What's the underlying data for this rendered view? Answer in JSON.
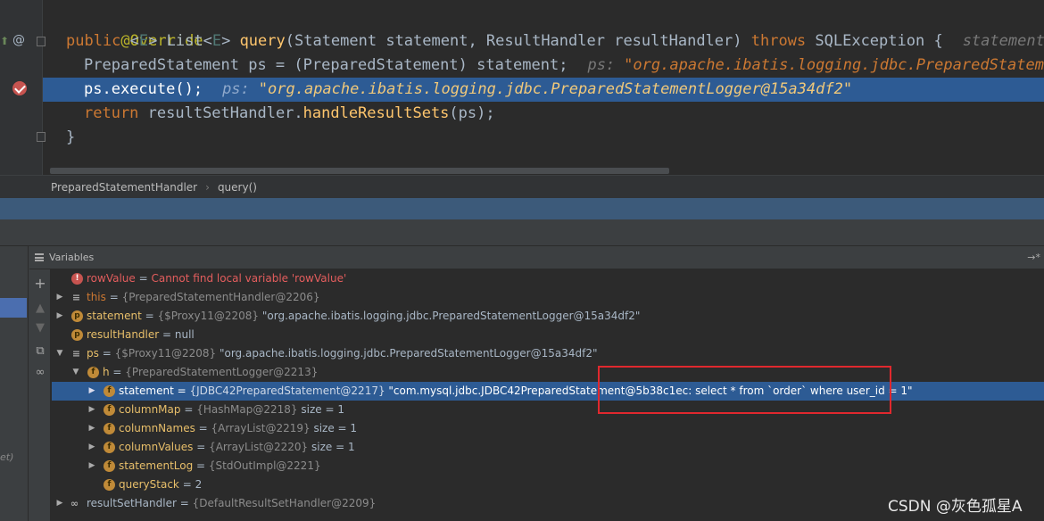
{
  "editor": {
    "lines": {
      "l1": "@Override",
      "l2_public": "public",
      "l2_lt": " <",
      "l2_E": "E",
      "l2_gt": "> ",
      "l2_list": "List<",
      "l2_E2": "E",
      "l2_gt2": "> ",
      "l2_query": "query",
      "l2_params": "(Statement statement, ResultHandler resultHandler) ",
      "l2_throws": "throws",
      "l2_exc": " SQLException {",
      "l2_hint": "statement: \"",
      "l3_code": "PreparedStatement ps = (PreparedStatement) statement;",
      "l3_hint_name": "ps:",
      "l3_hint_val": "\"org.apache.ibatis.logging.jdbc.PreparedStatement",
      "l4_code": "ps.execute();",
      "l4_hint_name": "ps:",
      "l4_hint_val": "\"org.apache.ibatis.logging.jdbc.PreparedStatementLogger@15a34df2\"",
      "l5_return": "return",
      "l5_code": " resultSetHandler.",
      "l5_fn": "handleResultSets",
      "l5_end": "(ps);",
      "l6": "}"
    },
    "gutter_at": "@"
  },
  "breadcrumb": {
    "class": "PreparedStatementHandler",
    "method": "query()"
  },
  "variables": {
    "title": "Variables",
    "pin": "→*",
    "frame_partial": "et)",
    "rows": [
      {
        "name": "rowValue",
        "eq": " = ",
        "value": "Cannot find local variable 'rowValue'"
      },
      {
        "name": "this",
        "eq": " = ",
        "ref": "{PreparedStatementHandler@2206}"
      },
      {
        "name": "statement",
        "eq": " = ",
        "ref": "{$Proxy11@2208}",
        "value": " \"org.apache.ibatis.logging.jdbc.PreparedStatementLogger@15a34df2\""
      },
      {
        "name": "resultHandler",
        "eq": " = ",
        "value": "null"
      },
      {
        "name": "ps",
        "eq": " = ",
        "ref": "{$Proxy11@2208}",
        "value": " \"org.apache.ibatis.logging.jdbc.PreparedStatementLogger@15a34df2\""
      },
      {
        "name": "h",
        "eq": " = ",
        "ref": "{PreparedStatementLogger@2213}"
      },
      {
        "name": "statement",
        "eq": " = ",
        "ref": "{JDBC42PreparedStatement@2217}",
        "value": " \"com.mysql.jdbc.JDBC42PreparedStatement@5b38c1ec: select * from `order` where user_id = 1\""
      },
      {
        "name": "columnMap",
        "eq": " = ",
        "ref": "{HashMap@2218}",
        "value": "  size = 1"
      },
      {
        "name": "columnNames",
        "eq": " = ",
        "ref": "{ArrayList@2219}",
        "value": "  size = 1"
      },
      {
        "name": "columnValues",
        "eq": " = ",
        "ref": "{ArrayList@2220}",
        "value": "  size = 1"
      },
      {
        "name": "statementLog",
        "eq": " = ",
        "ref": "{StdOutImpl@2221}"
      },
      {
        "name": "queryStack",
        "eq": " = ",
        "value": "2"
      },
      {
        "name": "resultSetHandler",
        "eq": " = ",
        "ref": "{DefaultResultSetHandler@2209}"
      }
    ]
  },
  "watermark": "CSDN @灰色孤星A",
  "colors": {
    "selection": "#2d5b94",
    "highlight_box": "#e0282e",
    "keyword": "#cc7832",
    "field": "#e8bf6a"
  }
}
